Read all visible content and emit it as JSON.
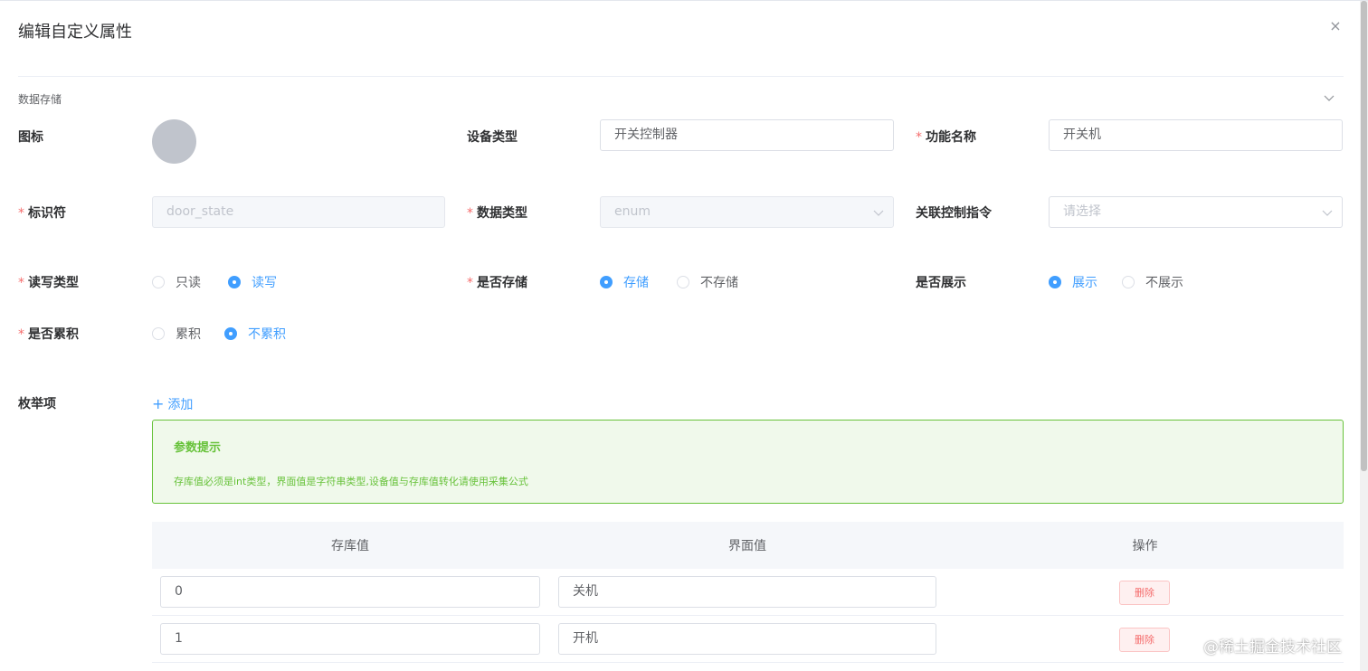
{
  "dialog": {
    "title": "编辑自定义属性",
    "close_label": "×"
  },
  "section": {
    "title": "数据存储"
  },
  "fields": {
    "icon_label": "图标",
    "device_type_label": "设备类型",
    "device_type_value": "开关控制器",
    "function_name_label": "功能名称",
    "function_name_value": "开关机",
    "identifier_label": "标识符",
    "identifier_value": "door_state",
    "data_type_label": "数据类型",
    "data_type_value": "enum",
    "control_cmd_label": "关联控制指令",
    "control_cmd_placeholder": "请选择",
    "rw_label": "读写类型",
    "rw_options": [
      "只读",
      "读写"
    ],
    "rw_selected": "读写",
    "store_label": "是否存储",
    "store_options": [
      "存储",
      "不存储"
    ],
    "store_selected": "存储",
    "display_label": "是否展示",
    "display_options": [
      "展示",
      "不展示"
    ],
    "display_selected": "展示",
    "accumulate_label": "是否累积",
    "accumulate_options": [
      "累积",
      "不累积"
    ],
    "accumulate_selected": "不累积",
    "required_mark": "*"
  },
  "enum": {
    "label": "枚举项",
    "add_label": "添加",
    "add_icon": "plus-icon",
    "alert_title": "参数提示",
    "alert_desc": "存库值必须是int类型，界面值是字符串类型,设备值与存库值转化请使用采集公式",
    "columns": [
      "存库值",
      "界面值",
      "操作"
    ],
    "rows": [
      {
        "store_value": "0",
        "display_value": "关机",
        "action": "删除"
      },
      {
        "store_value": "1",
        "display_value": "开机",
        "action": "删除"
      }
    ]
  },
  "watermark": "@稀土掘金技术社区",
  "colors": {
    "primary": "#409eff",
    "success": "#67c23a",
    "danger": "#f56c6c"
  }
}
